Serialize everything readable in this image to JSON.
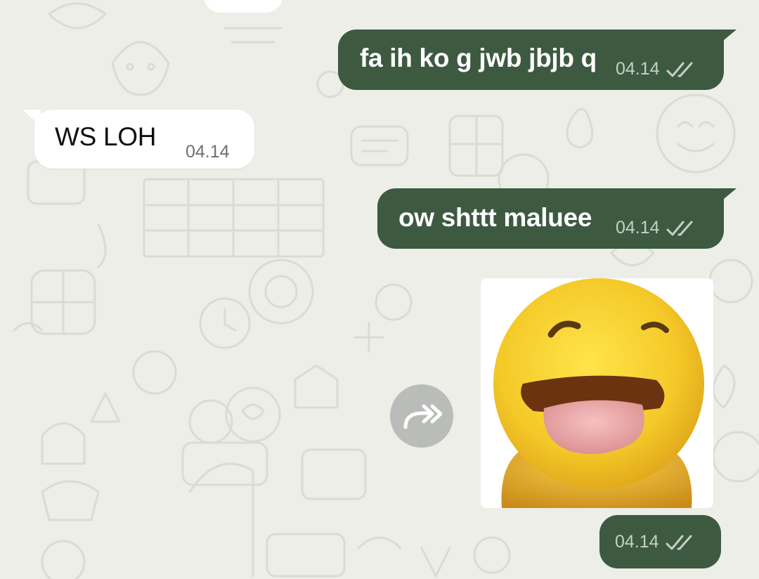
{
  "messages": [
    {
      "direction": "outgoing",
      "text": "fa ih ko g jwb jbjb q",
      "time": "04.14",
      "status": "double-check-icon"
    },
    {
      "direction": "incoming",
      "text": "WS LOH",
      "time": "04.14"
    },
    {
      "direction": "outgoing",
      "text": "ow shttt maluee",
      "time": "04.14",
      "status": "double-check-icon"
    },
    {
      "direction": "outgoing",
      "type": "sticker",
      "sticker": "yellow-tongue-face-sticker"
    },
    {
      "direction": "outgoing",
      "type": "timestamp",
      "time": "04.14",
      "status": "double-check-icon"
    }
  ],
  "icons": {
    "forward": "forward-icon"
  },
  "colors": {
    "outgoing_bubble": "#3d5a41",
    "incoming_bubble": "#ffffff",
    "background": "#eceee7",
    "wallpaper_doodle": "#d8ddd3"
  }
}
